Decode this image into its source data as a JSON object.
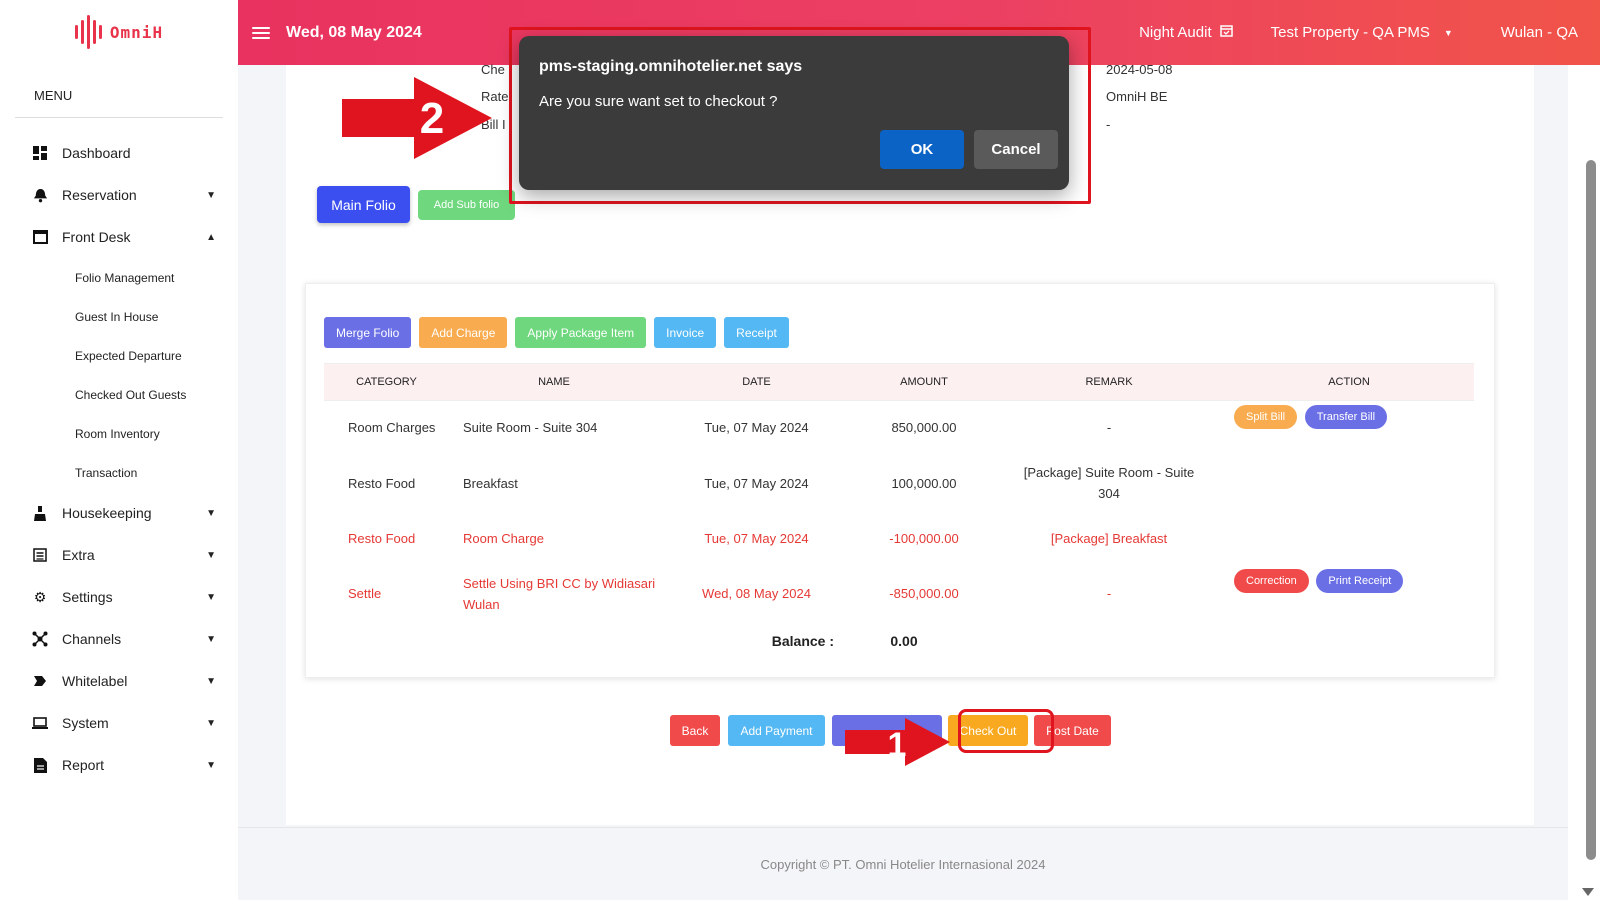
{
  "brand": {
    "name": "OmniH"
  },
  "sidebar": {
    "menu_title": "MENU",
    "items": [
      {
        "label": "Dashboard",
        "icon": "dashboard-icon",
        "chevron": ""
      },
      {
        "label": "Reservation",
        "icon": "bell-icon",
        "chevron": "down"
      },
      {
        "label": "Front Desk",
        "icon": "window-icon",
        "chevron": "up"
      },
      {
        "label": "Housekeeping",
        "icon": "cleaning-icon",
        "chevron": "down"
      },
      {
        "label": "Extra",
        "icon": "list-icon",
        "chevron": "down"
      },
      {
        "label": "Settings",
        "icon": "gear-icon",
        "chevron": "down"
      },
      {
        "label": "Channels",
        "icon": "network-icon",
        "chevron": "down"
      },
      {
        "label": "Whitelabel",
        "icon": "tag-icon",
        "chevron": "down"
      },
      {
        "label": "System",
        "icon": "laptop-icon",
        "chevron": "down"
      },
      {
        "label": "Report",
        "icon": "report-icon",
        "chevron": "down"
      }
    ],
    "front_desk_sub": [
      "Folio Management",
      "Guest In House",
      "Expected Departure",
      "Checked Out Guests",
      "Room Inventory",
      "Transaction"
    ]
  },
  "topbar": {
    "date": "Wed, 08 May 2024",
    "night_audit": "Night Audit",
    "property": "Test Property - QA PMS",
    "user": "Wulan - QA"
  },
  "info": {
    "label1": "Che",
    "label2": "Rate",
    "label3": "Bill I",
    "value1": "2024-05-08",
    "value2": "OmniH BE",
    "value3": "-"
  },
  "folio_tabs": {
    "main": "Main Folio",
    "add_sub": "Add Sub folio"
  },
  "actions": {
    "merge": "Merge Folio",
    "add_charge": "Add Charge",
    "apply_package": "Apply Package Item",
    "invoice": "Invoice",
    "receipt": "Receipt"
  },
  "table": {
    "headers": [
      "CATEGORY",
      "NAME",
      "DATE",
      "AMOUNT",
      "REMARK",
      "ACTION"
    ],
    "rows": [
      {
        "category": "Room Charges",
        "name": "Suite Room - Suite 304",
        "date": "Tue, 07 May 2024",
        "amount": "850,000.00",
        "remark": "-",
        "actions": [
          "Split Bill",
          "Transfer Bill"
        ],
        "highlight": false
      },
      {
        "category": "Resto Food",
        "name": "Breakfast",
        "date": "Tue, 07 May 2024",
        "amount": "100,000.00",
        "remark": "[Package] Suite Room - Suite 304",
        "actions": [],
        "highlight": false
      },
      {
        "category": "Resto Food",
        "name": "Room Charge",
        "date": "Tue, 07 May 2024",
        "amount": "-100,000.00",
        "remark": "[Package] Breakfast",
        "actions": [],
        "highlight": true
      },
      {
        "category": "Settle",
        "name": "Settle Using BRI CC by Widiasari Wulan",
        "date": "Wed, 08 May 2024",
        "amount": "-850,000.00",
        "remark": "-",
        "actions": [
          "Correction",
          "Print Receipt"
        ],
        "highlight": true
      }
    ],
    "balance_label": "Balance :",
    "balance_value": "0.00"
  },
  "bottom": {
    "back": "Back",
    "add_payment": "Add Payment",
    "check_out": "Check Out",
    "post_date": "Post Date"
  },
  "footer": {
    "copyright": "Copyright © PT. Omni Hotelier Internasional 2024"
  },
  "dialog": {
    "title": "pms-staging.omnihotelier.net says",
    "message": "Are you sure want set to checkout ?",
    "ok": "OK",
    "cancel": "Cancel"
  },
  "annotations": {
    "step1": "1",
    "step2": "2"
  },
  "colors": {
    "brand_red": "#e8334a",
    "topbar_start": "#e9325f",
    "topbar_end": "#f15449",
    "blue_primary": "#3b4ef0",
    "indigo": "#6a6fe6",
    "orange": "#f8ab4f",
    "green": "#6fd77d",
    "cyan": "#53b8f3",
    "red_btn": "#f04a4a",
    "checkout": "#f9a91f",
    "annotation_red": "#e0141e"
  }
}
